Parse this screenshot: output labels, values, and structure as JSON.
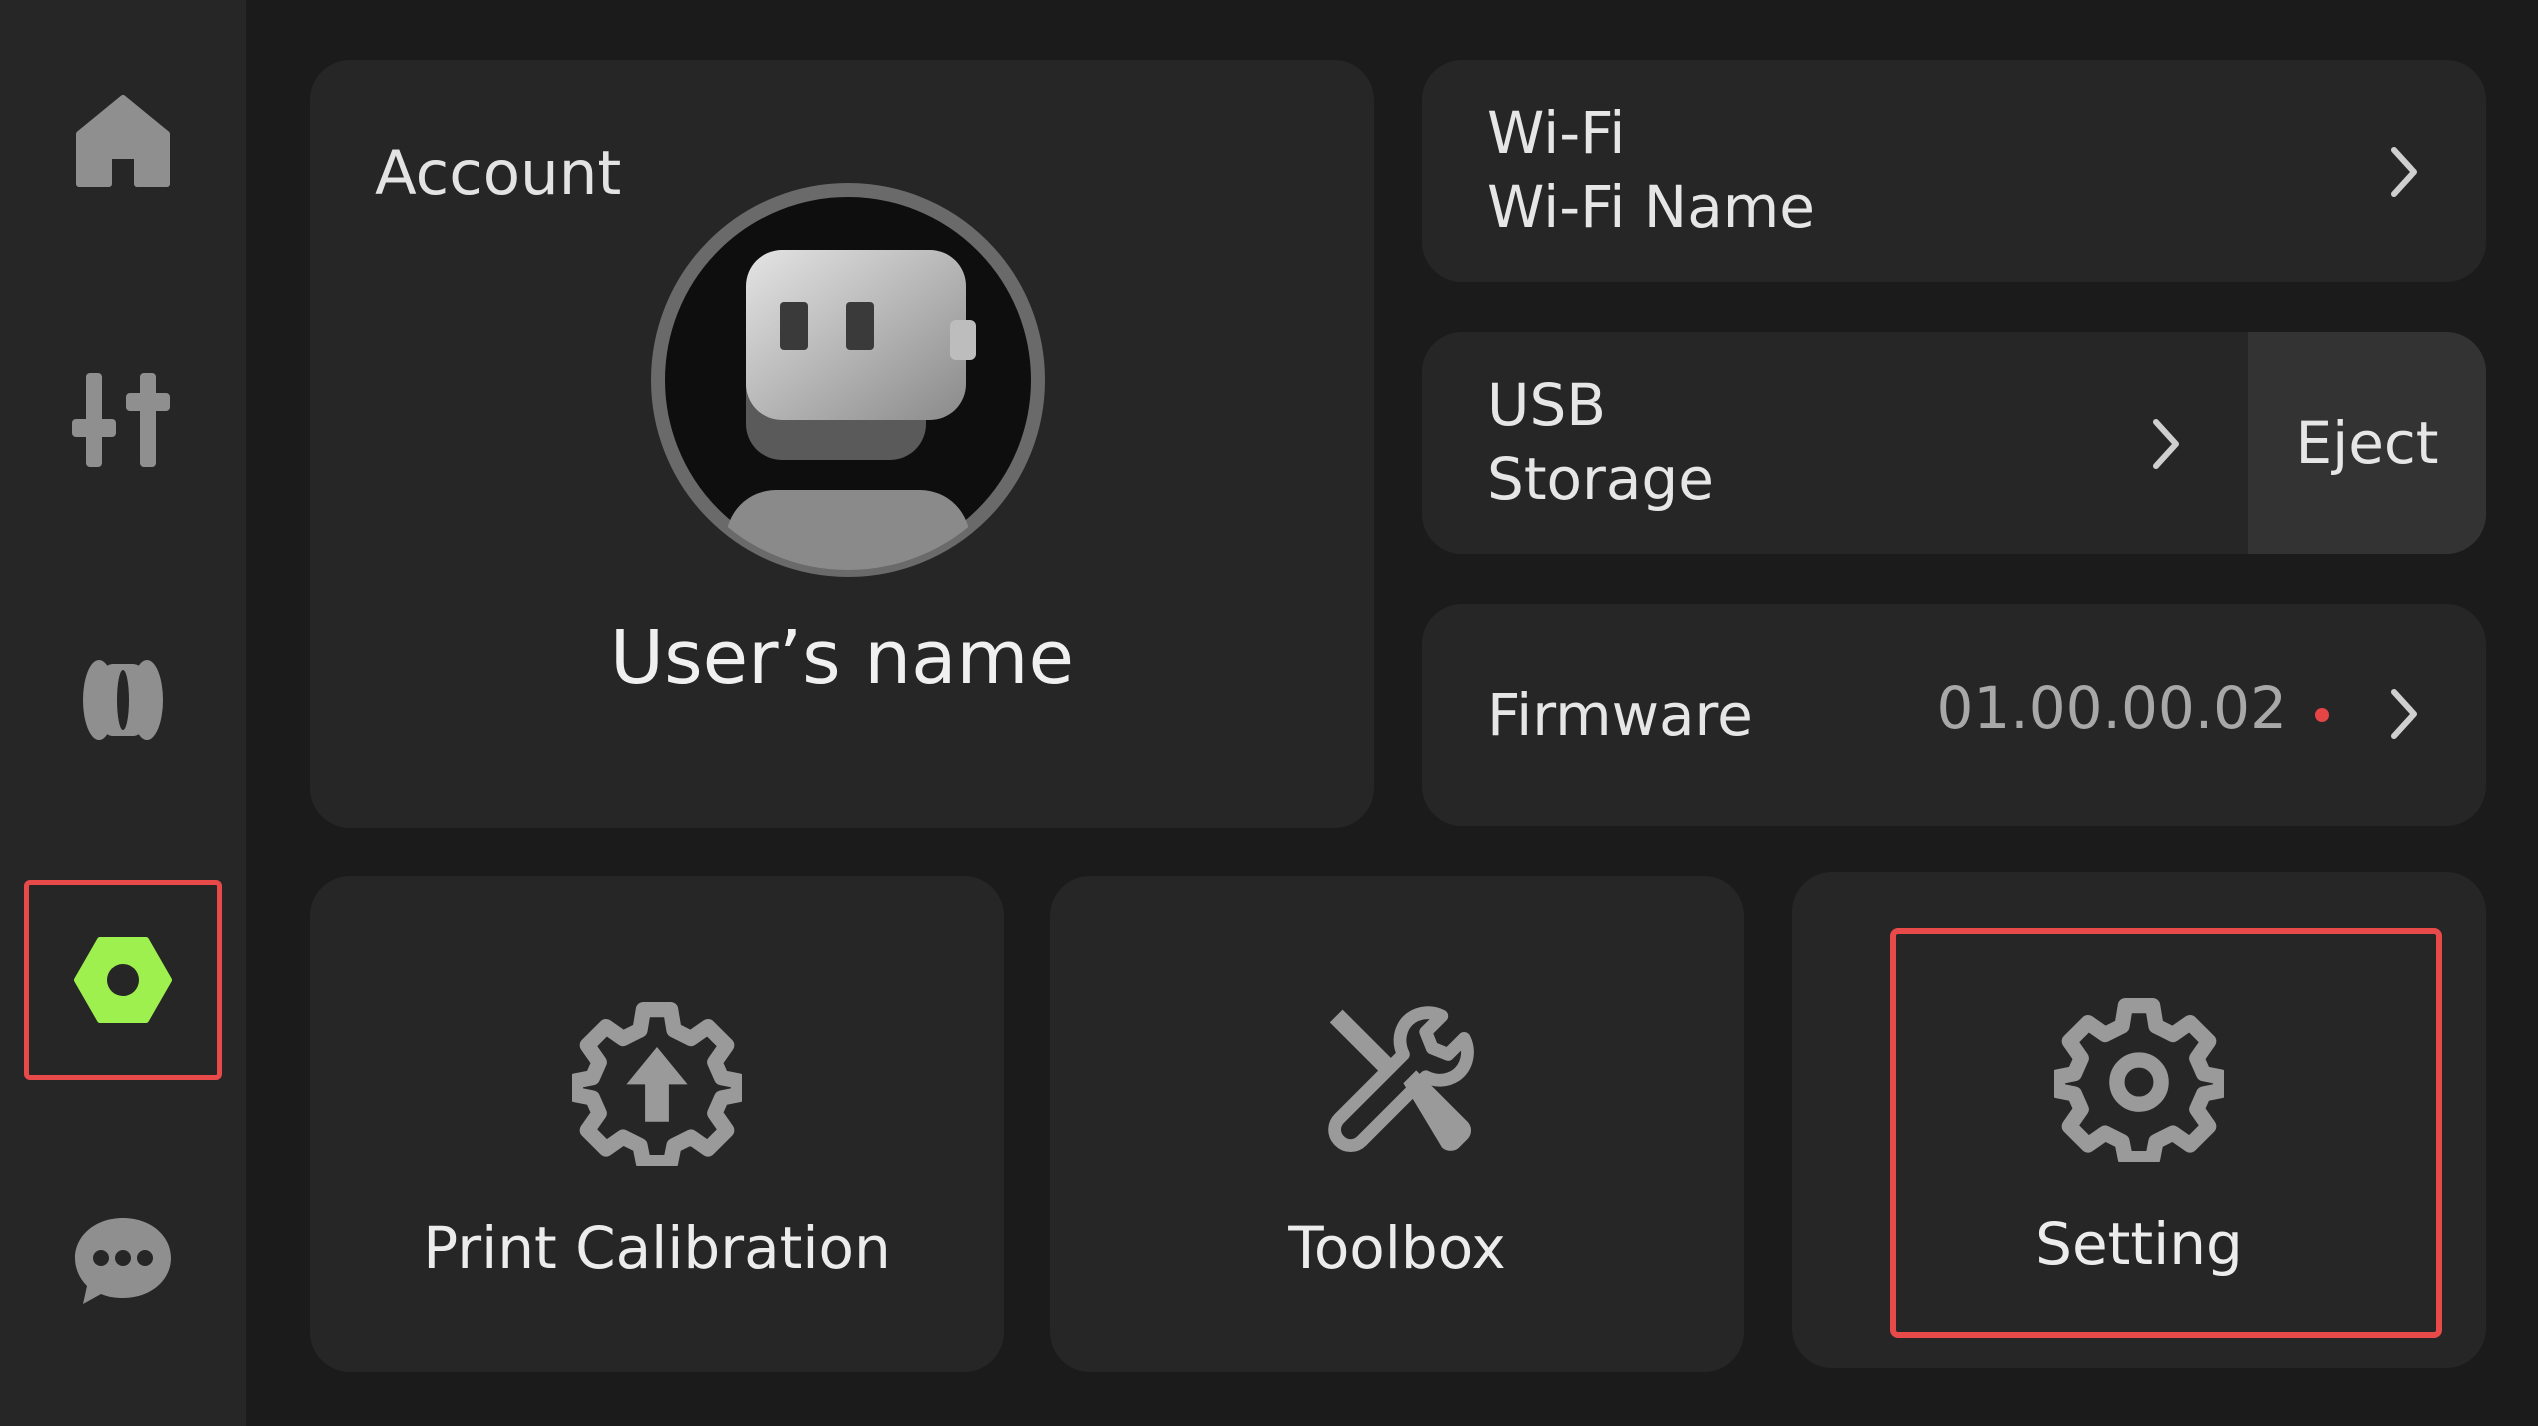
{
  "sidebar": {
    "items": [
      {
        "icon": "home-icon",
        "selected": false
      },
      {
        "icon": "sliders-icon",
        "selected": false
      },
      {
        "icon": "filament-spool-icon",
        "selected": false
      },
      {
        "icon": "hex-nut-icon",
        "selected": true
      },
      {
        "icon": "chat-bubble-icon",
        "selected": false
      }
    ],
    "accent_color": "#9ef04e"
  },
  "account": {
    "label": "Account",
    "user_name": "User’s name",
    "avatar_icon": "robot-avatar-icon"
  },
  "wifi": {
    "title": "Wi-Fi",
    "name": "Wi-Fi Name"
  },
  "usb": {
    "title_line1": "USB",
    "title_line2": "Storage",
    "eject_label": "Eject"
  },
  "firmware": {
    "title": "Firmware",
    "version": "01.00.00.02",
    "update_dot_color": "#e64545"
  },
  "tiles": [
    {
      "label": "Print Calibration",
      "icon": "gear-upload-icon"
    },
    {
      "label": "Toolbox",
      "icon": "tools-icon"
    },
    {
      "label": "Setting",
      "icon": "gear-icon"
    }
  ],
  "highlight_color": "#e84a4a"
}
